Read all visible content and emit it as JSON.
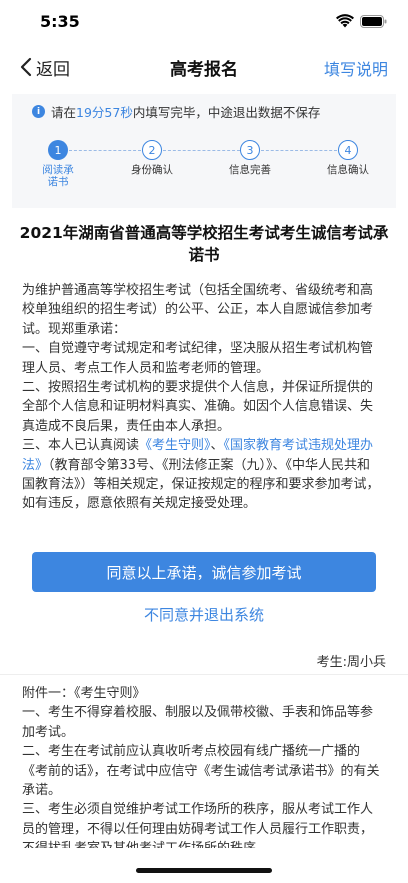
{
  "status_bar": {
    "time": "5:35"
  },
  "nav": {
    "back_label": "返回",
    "title": "高考报名",
    "help_label": "填写说明"
  },
  "notice": {
    "prefix": "请在",
    "time_left": "19分57秒",
    "suffix": "内填写完毕，中途退出数据不保存"
  },
  "steps": [
    {
      "number": "1",
      "label": "阅读承诺书",
      "active": true
    },
    {
      "number": "2",
      "label": "身份确认",
      "active": false
    },
    {
      "number": "3",
      "label": "信息完善",
      "active": false
    },
    {
      "number": "4",
      "label": "信息确认",
      "active": false
    }
  ],
  "document": {
    "title": "2021年湖南省普通高等学校招生考试考生诚信考试承诺书",
    "intro": "为维护普通高等学校招生考试（包括全国统考、省级统考和高校单独组织的招生考试）的公平、公正，本人自愿诚信参加考试。现郑重承诺：",
    "item1": "一、自觉遵守考试规定和考试纪律，坚决服从招生考试机构管理人员、考点工作人员和监考老师的管理。",
    "item2": "二、按照招生考试机构的要求提供个人信息，并保证所提供的全部个人信息和证明材料真实、准确。如因个人信息错误、失真造成不良后果，责任由本人承担。",
    "item3_prefix": "三、本人已认真阅读",
    "item3_link1": "《考生守则》",
    "item3_sep": "、",
    "item3_link2": "《国家教育考试违规处理办法》",
    "item3_suffix": "（教育部令第33号、《刑法修正案（九）》、《中华人民共和国教育法》）等相关规定，保证按规定的程序和要求参加考试，如有违反，愿意依照有关规定接受处理。"
  },
  "actions": {
    "agree_label": "同意以上承诺，诚信参加考试",
    "decline_label": "不同意并退出系统"
  },
  "signature": "考生:周小兵",
  "appendix": {
    "heading": "附件一：《考生守则》",
    "items": [
      "一、考生不得穿着校服、制服以及佩带校徽、手表和饰品等参加考试。",
      "二、考生在考试前应认真收听考点校园有线广播统一广播的《考前的话》，在考试中应信守《考生诚信考试承诺书》的有关承诺。",
      "三、考生必须自觉维护考试工作场所的秩序，服从考试工作人员的管理，不得以任何理由妨碍考试工作人员履行工作职责，不得扰乱考室及其他考试工作场所的秩序。"
    ]
  },
  "colors": {
    "accent": "#3d86e0",
    "card_bg": "#f6f7f9"
  }
}
